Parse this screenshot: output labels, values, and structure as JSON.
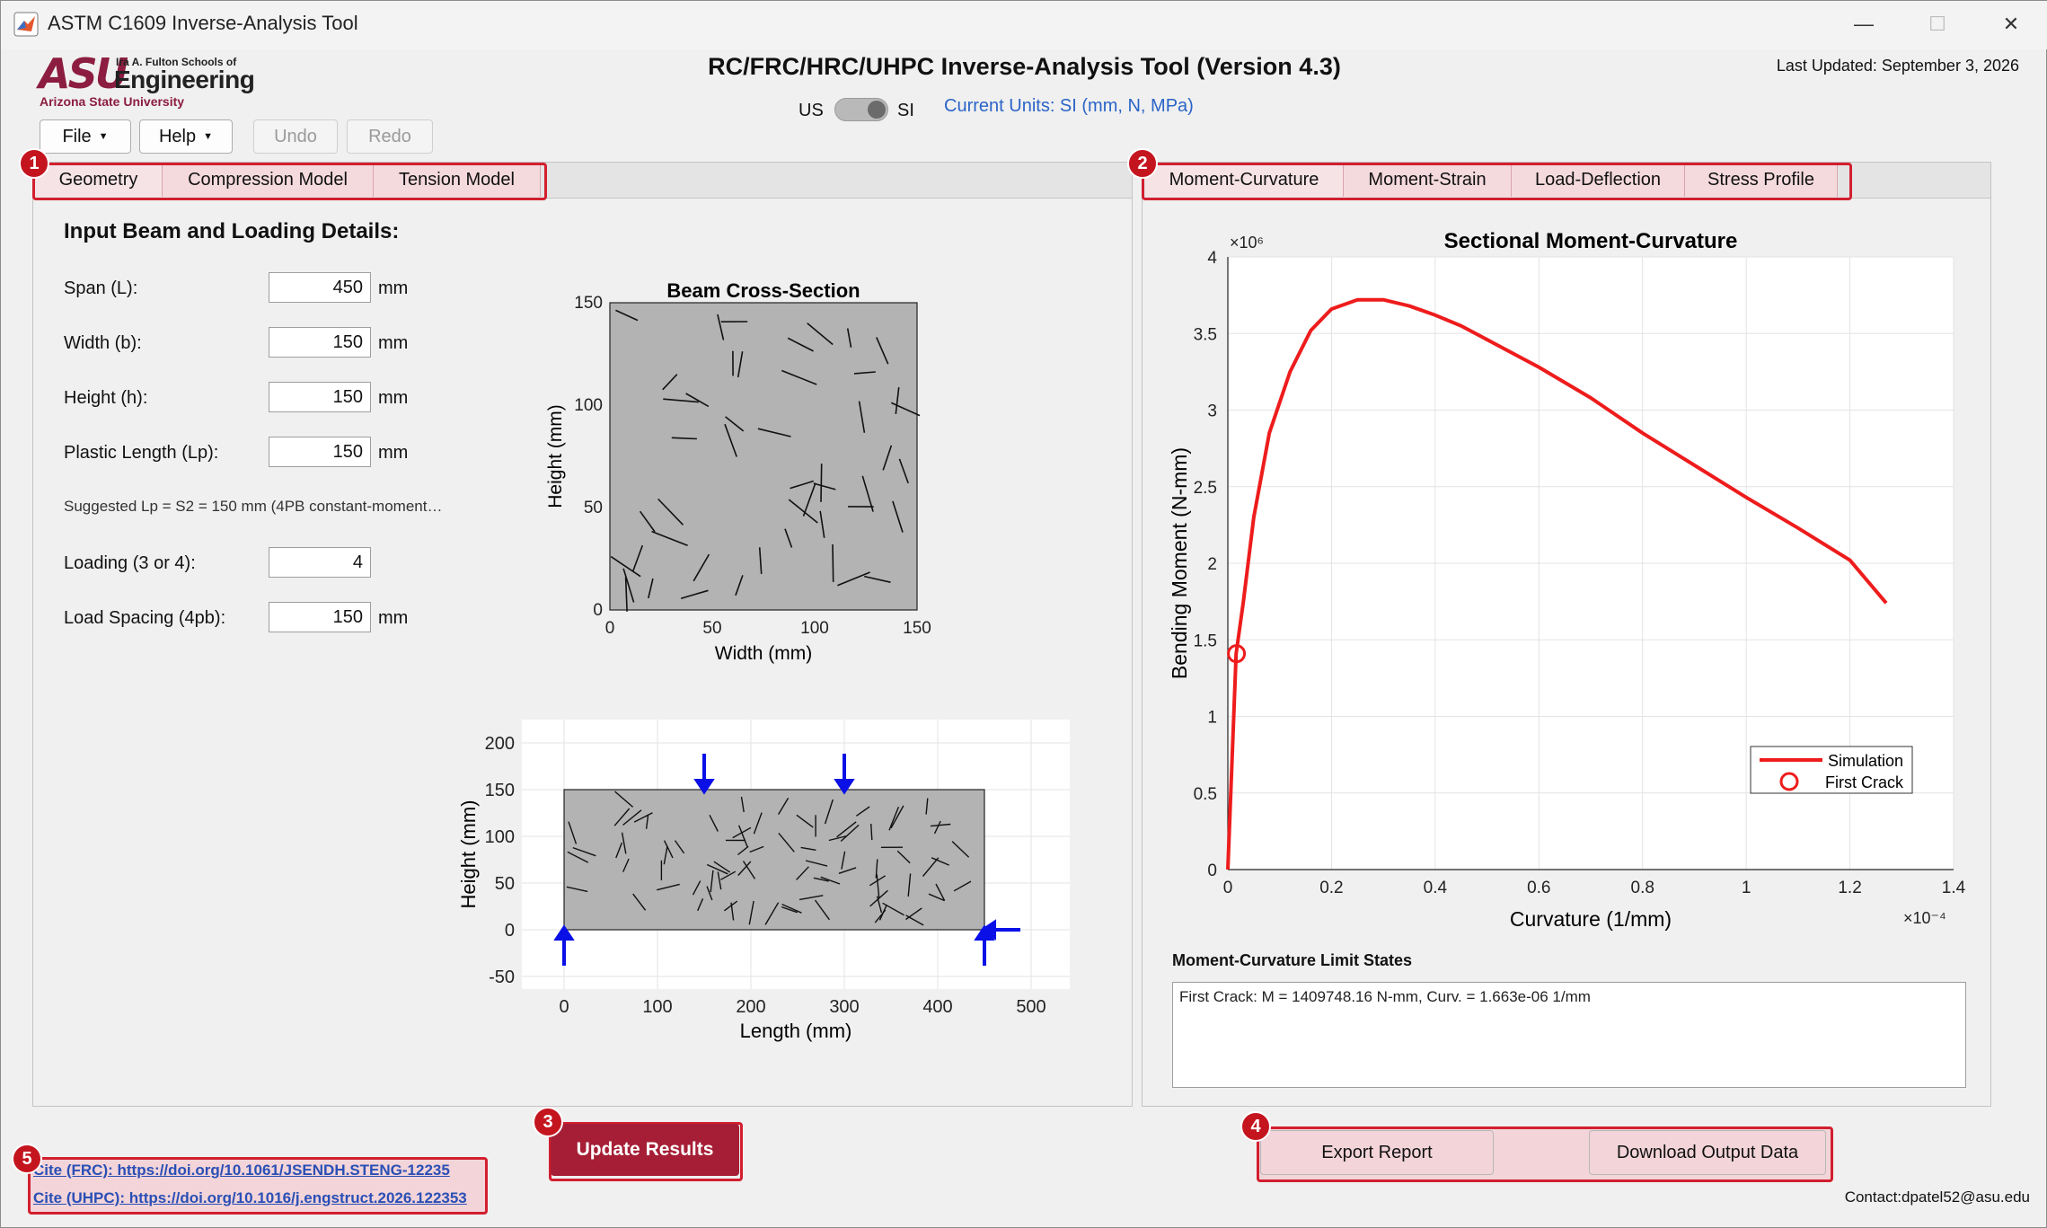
{
  "window": {
    "title": "ASTM C1609 Inverse-Analysis Tool",
    "minimize": "—",
    "maximize": "☐",
    "close": "✕"
  },
  "header": {
    "logo_asu": "ASU",
    "logo_school": "Ira A. Fulton Schools of",
    "logo_engineering": "Engineering",
    "logo_university": "Arizona State University",
    "app_title": "RC/FRC/HRC/UHPC Inverse-Analysis Tool (Version 4.3)",
    "last_updated": "Last Updated: September 3, 2026",
    "units_left": "US",
    "units_right": "SI",
    "current_units": "Current Units: SI (mm, N, MPa)"
  },
  "toolbar": {
    "file": "File",
    "help": "Help",
    "undo": "Undo",
    "redo": "Redo"
  },
  "left_tabs": [
    "Geometry",
    "Compression Model",
    "Tension Model"
  ],
  "right_tabs": [
    "Moment-Curvature",
    "Moment-Strain",
    "Load-Deflection",
    "Stress Profile"
  ],
  "badges": [
    "1",
    "2",
    "3",
    "4",
    "5"
  ],
  "geometry": {
    "heading": "Input Beam and Loading Details:",
    "fields": [
      {
        "label": "Span (L):",
        "value": "450",
        "unit": "mm"
      },
      {
        "label": "Width (b):",
        "value": "150",
        "unit": "mm"
      },
      {
        "label": "Height (h):",
        "value": "150",
        "unit": "mm"
      },
      {
        "label": "Plastic Length (Lp):",
        "value": "150",
        "unit": "mm"
      },
      {
        "label": "Loading (3 or 4):",
        "value": "4",
        "unit": ""
      },
      {
        "label": "Load Spacing (4pb):",
        "value": "150",
        "unit": "mm"
      }
    ],
    "hint": "Suggested Lp = S2 = 150 mm (4PB constant-moment…"
  },
  "cross_section": {
    "title": "Beam Cross-Section",
    "xlabel": "Width (mm)",
    "ylabel": "Height (mm)",
    "xticks": [
      "0",
      "50",
      "100",
      "150"
    ],
    "yticks": [
      "0",
      "50",
      "100",
      "150"
    ]
  },
  "beam_elevation": {
    "xlabel": "Length (mm)",
    "ylabel": "Height (mm)",
    "xticks": [
      "0",
      "100",
      "200",
      "300",
      "400",
      "500"
    ],
    "yticks": [
      "-50",
      "0",
      "50",
      "100",
      "150",
      "200"
    ]
  },
  "chart_data": {
    "type": "line",
    "title": "Sectional Moment-Curvature",
    "xlabel": "Curvature (1/mm)",
    "ylabel": "Bending Moment (N-mm)",
    "x_exponent": "×10⁻⁴",
    "y_exponent": "×10⁶",
    "xlim": [
      0,
      0.00014
    ],
    "ylim": [
      0,
      4000000.0
    ],
    "xticks": [
      "0",
      "0.2",
      "0.4",
      "0.6",
      "0.8",
      "1",
      "1.2",
      "1.4"
    ],
    "yticks": [
      "0",
      "0.5",
      "1",
      "1.5",
      "2",
      "2.5",
      "3",
      "3.5",
      "4"
    ],
    "grid": true,
    "legend_position": "bottom-right",
    "series": [
      {
        "name": "Simulation",
        "color": "#ee1c1c",
        "x": [
          0,
          1.6e-06,
          3e-06,
          5e-06,
          8e-06,
          1.2e-05,
          1.6e-05,
          2e-05,
          2.5e-05,
          3e-05,
          3.5e-05,
          4e-05,
          4.5e-05,
          5e-05,
          6e-05,
          7e-05,
          8e-05,
          9e-05,
          0.0001,
          0.00011,
          0.00012,
          0.000127
        ],
        "y": [
          0,
          1409748,
          1750000,
          2300000,
          2850000,
          3250000,
          3520000,
          3660000,
          3720000,
          3720000,
          3680000,
          3620000,
          3550000,
          3460000,
          3280000,
          3080000,
          2850000,
          2640000,
          2430000,
          2230000,
          2020000,
          1740000
        ]
      }
    ],
    "markers": [
      {
        "name": "First Crack",
        "x": 1.663e-06,
        "y": 1409748.16,
        "color": "#ee1c1c"
      }
    ]
  },
  "limit_states": {
    "title": "Moment-Curvature Limit States",
    "text": "First Crack: M = 1409748.16 N-mm, Curv. = 1.663e-06 1/mm"
  },
  "actions": {
    "update": "Update Results",
    "export": "Export Report",
    "download": "Download Output Data"
  },
  "citations": {
    "frc": "Cite (FRC): https://doi.org/10.1061/JSENDH.STENG-12235",
    "uhpc": "Cite (UHPC): https://doi.org/10.1016/j.engstruct.2026.122353"
  },
  "contact": "Contact:dpatel52@asu.edu",
  "colors": {
    "accent": "#a61e35",
    "highlight": "#d21f2f",
    "link": "#2a64c7",
    "plot_line": "#ee1c1c",
    "load_arrow": "#0a10e6",
    "section_fill": "#b3b3b3"
  }
}
